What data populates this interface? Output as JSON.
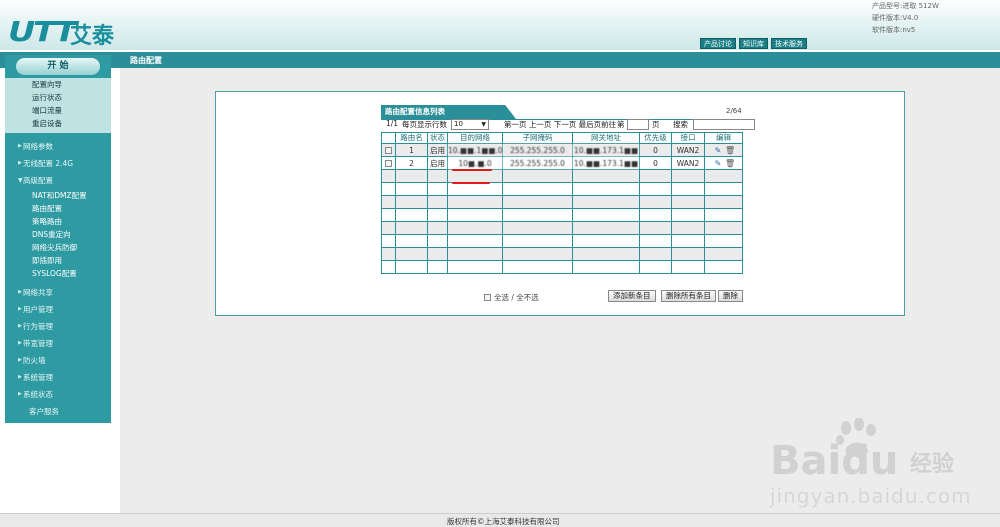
{
  "header": {
    "logo_latin": "UTT",
    "logo_cn": "艾泰",
    "product_model": "产品型号:进取 512W",
    "hardware_version": "硬件版本:V4.0",
    "software_version": "软件版本:nv5",
    "links": [
      "产品讨论",
      "知识库",
      "技术服务"
    ]
  },
  "bar": {
    "title": "路由配置"
  },
  "sidebar": {
    "start_label": "开 始",
    "quick": [
      "配置向导",
      "运行状态",
      "端口流量",
      "重启设备"
    ],
    "menu_top": [
      "网络参数",
      "无线配置 2.4G"
    ],
    "open_menu": "高级配置",
    "sub_items": [
      "NAT和DMZ配置",
      "路由配置",
      "策略路由",
      "DNS重定向",
      "网络尖兵防御",
      "即插即用",
      "SYSLOG配置"
    ],
    "menu_bottom": [
      "网络共享",
      "用户管理",
      "行为管理",
      "带宽管理",
      "防火墙",
      "系统管理",
      "系统状态"
    ],
    "customer_service": "客户服务"
  },
  "list": {
    "tab_title": "路由配置信息列表",
    "page_count": "2/64",
    "pager": {
      "page_info": "1/1",
      "rows_label": "每页显示行数",
      "rows_value": "10",
      "nav": "第一页 上一页 下一页 最后页",
      "goto_label": "前往",
      "page_prefix": "第",
      "page_suffix": "页",
      "search_label": "搜索"
    },
    "columns": [
      "",
      "路由名",
      "状态",
      "目的网络",
      "子网掩码",
      "网关地址",
      "优先级",
      "接口",
      "编辑"
    ],
    "rows": [
      {
        "name": "1",
        "status": "启用",
        "dest": "10.■■.1■■.0",
        "mask": "255.255.255.0",
        "gateway": "10.■■.173.1■■",
        "priority": "0",
        "iface": "WAN2"
      },
      {
        "name": "2",
        "status": "启用",
        "dest": "10■.■.0",
        "mask": "255.255.255.0",
        "gateway": "10.■■.173.1■■",
        "priority": "0",
        "iface": "WAN2"
      }
    ],
    "select_all": "全选 / 全不选",
    "buttons": {
      "add": "添加新条目",
      "delete_all": "删除所有条目",
      "delete": "删除"
    }
  },
  "footer": {
    "copyright": "版权所有©上海艾泰科技有限公司"
  },
  "watermark": {
    "brand": "Baidu",
    "brand_cn": "经验",
    "url": "jingyan.baidu.com"
  },
  "colors": {
    "teal": "#2a8f98",
    "sidebar": "#2e9aa2",
    "annotation_red": "#e3191c"
  }
}
